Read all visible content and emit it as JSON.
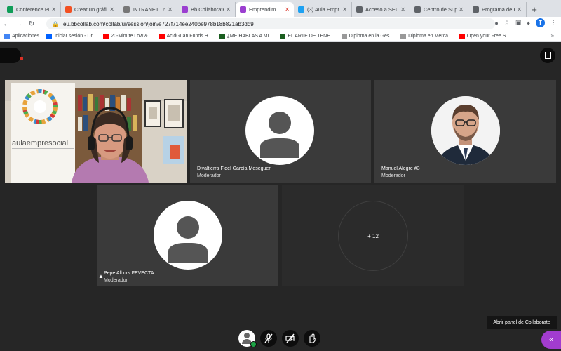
{
  "browser": {
    "tabs": [
      {
        "title": "Conference Pr",
        "color": "#0f9d58",
        "active": false
      },
      {
        "title": "Crear un gráfic",
        "color": "#f25022",
        "active": false
      },
      {
        "title": "INTRANET UV",
        "color": "#777777",
        "active": false
      },
      {
        "title": "Bb Collaborate",
        "color": "#9b3fd0",
        "active": false
      },
      {
        "title": "Emprendim",
        "color": "#9b3fd0",
        "active": true
      },
      {
        "title": "(3) Aula Empr",
        "color": "#1da1f2",
        "active": false
      },
      {
        "title": "Acceso a SEU",
        "color": "#5f6368",
        "active": false
      },
      {
        "title": "Centro de Sup",
        "color": "#5f6368",
        "active": false
      },
      {
        "title": "Programa de P",
        "color": "#5f6368",
        "active": false
      }
    ],
    "new_tab_label": "+",
    "url": "eu.bbcollab.com/collab/ui/session/join/e727f714ee240be978b18b821ab3dd9",
    "profile_initial": "T",
    "bookmarks": [
      {
        "label": "Aplicaciones",
        "color": "#4285f4"
      },
      {
        "label": "Iniciar sesión - Dr...",
        "color": "#0061ff"
      },
      {
        "label": "20-Minute Low &...",
        "color": "#ff0000"
      },
      {
        "label": "AcidGuan Funds H...",
        "color": "#ff0000"
      },
      {
        "label": "¿ME HABLAS A MI...",
        "color": "#1b5e20"
      },
      {
        "label": "EL ARTE DE TENE...",
        "color": "#1b5e20"
      },
      {
        "label": "Diploma en la Ges...",
        "color": "#999999"
      },
      {
        "label": "Diploma en Merca...",
        "color": "#999999"
      },
      {
        "label": "Open your Free S...",
        "color": "#ff0000"
      }
    ],
    "bookmarks_more": "»"
  },
  "session": {
    "participants": [
      {
        "name": "",
        "role": ""
      },
      {
        "name": "Divaltierra Fidel García Meseguer",
        "role": "Moderador"
      },
      {
        "name": "Manuel Alegre #3",
        "role": "Moderador"
      },
      {
        "name": "Pepe Albors FEVECTA",
        "role": "Moderador"
      }
    ],
    "more_count": "+ 12",
    "video_banner_text": "aulaempresocial",
    "tooltip": "Abrir panel de Collaborate"
  },
  "colors": {
    "stage_bg": "#262626",
    "tile_bg": "#3a3a3a",
    "collab_purple": "#a23ccf",
    "status_green": "#1ea446"
  }
}
